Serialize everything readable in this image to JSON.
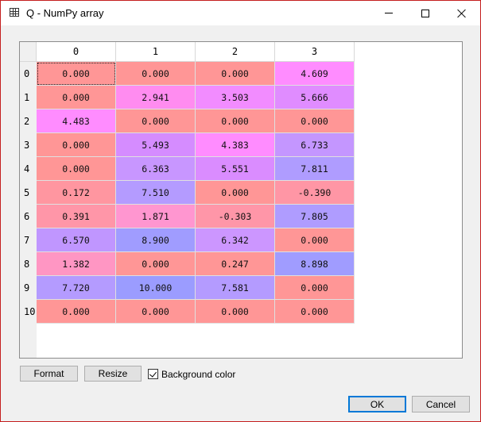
{
  "window": {
    "title": "Q - NumPy array"
  },
  "table": {
    "columns": [
      "0",
      "1",
      "2",
      "3"
    ],
    "rows": [
      "0",
      "1",
      "2",
      "3",
      "4",
      "5",
      "6",
      "7",
      "8",
      "9",
      "10"
    ],
    "cells": [
      [
        "0.000",
        "0.000",
        "0.000",
        "4.609"
      ],
      [
        "0.000",
        "2.941",
        "3.503",
        "5.666"
      ],
      [
        "4.483",
        "0.000",
        "0.000",
        "0.000"
      ],
      [
        "0.000",
        "5.493",
        "4.383",
        "6.733"
      ],
      [
        "0.000",
        "6.363",
        "5.551",
        "7.811"
      ],
      [
        "0.172",
        "7.510",
        "0.000",
        "-0.390"
      ],
      [
        "0.391",
        "1.871",
        "-0.303",
        "7.805"
      ],
      [
        "6.570",
        "8.900",
        "6.342",
        "0.000"
      ],
      [
        "1.382",
        "0.000",
        "0.247",
        "8.898"
      ],
      [
        "7.720",
        "10.000",
        "7.581",
        "0.000"
      ],
      [
        "0.000",
        "0.000",
        "0.000",
        "0.000"
      ]
    ],
    "cell_colors": [
      [
        "#ff9696",
        "#ff9696",
        "#ff9696",
        "#ff8cff"
      ],
      [
        "#ff9696",
        "#ff8cf0",
        "#f28cff",
        "#e08cff"
      ],
      [
        "#ff8cff",
        "#ff9696",
        "#ff9696",
        "#ff9696"
      ],
      [
        "#ff9696",
        "#d58cff",
        "#ff8cff",
        "#c496ff"
      ],
      [
        "#ff9696",
        "#c896ff",
        "#da8cff",
        "#af9cff"
      ],
      [
        "#ff96a0",
        "#b49bff",
        "#ff9696",
        "#ff96a5"
      ],
      [
        "#ff96a8",
        "#ff96d0",
        "#ff96a8",
        "#af9cff"
      ],
      [
        "#c096ff",
        "#a09cff",
        "#cc96ff",
        "#ff9696"
      ],
      [
        "#ff96c3",
        "#ff9696",
        "#ff9696",
        "#a09cff"
      ],
      [
        "#b49bff",
        "#9b9cff",
        "#b49bff",
        "#ff9696"
      ],
      [
        "#ff9696",
        "#ff9696",
        "#ff9696",
        "#ff9696"
      ]
    ],
    "selected_cell": [
      0,
      0
    ]
  },
  "controls": {
    "format_label": "Format",
    "resize_label": "Resize",
    "background_color_label": "Background color",
    "background_color_checked": true,
    "ok_label": "OK",
    "cancel_label": "Cancel"
  }
}
